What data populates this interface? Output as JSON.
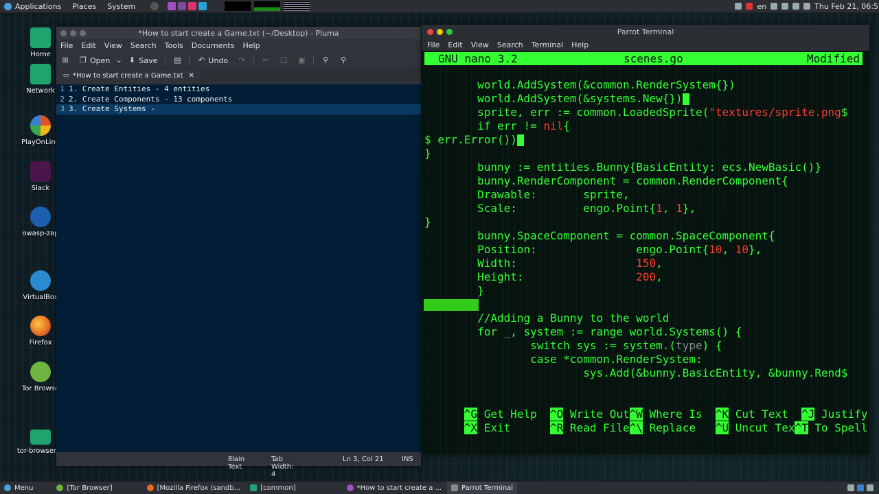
{
  "top_panel": {
    "applications": "Applications",
    "places": "Places",
    "system": "System",
    "keyboard_layout": "en",
    "clock": "Thu Feb 21, 06:55"
  },
  "desktop_icons": [
    {
      "label": "Home",
      "color": "#1fa36f"
    },
    {
      "label": "Network",
      "color": "#1fa36f"
    },
    {
      "label": "PlayOnLinu",
      "color": "#e0532a"
    },
    {
      "label": "Slack",
      "color": "#6a2b6a"
    },
    {
      "label": "owasp-zap",
      "color": "#1d5fae"
    },
    {
      "label": "VirtualBox",
      "color": "#2a8bd2"
    },
    {
      "label": "Firefox",
      "color": "#e66a1f"
    },
    {
      "label": "Tor Browse",
      "color": "#6fb43f"
    },
    {
      "label": "tor-browser_e",
      "color": "#1fa36f"
    }
  ],
  "pluma": {
    "title": "*How to start create a Game.txt (~/Desktop) - Pluma",
    "menu": [
      "File",
      "Edit",
      "View",
      "Search",
      "Tools",
      "Documents",
      "Help"
    ],
    "toolbar": {
      "open": "Open",
      "save": "Save",
      "undo": "Undo"
    },
    "tab_label": "*How to start create a Game.txt",
    "lines": [
      {
        "num": "1",
        "text": "1. Create Entities - 4 entities"
      },
      {
        "num": "2",
        "text": "2. Create Components - 13 components"
      },
      {
        "num": "3",
        "text": "3. Create Systems -"
      }
    ],
    "status": {
      "mode": "Plain Text",
      "tab_width": "Tab Width: 4",
      "position": "Ln 3, Col 21",
      "insert": "INS"
    }
  },
  "terminal": {
    "title": "Parrot Terminal",
    "menu": [
      "File",
      "Edit",
      "View",
      "Search",
      "Terminal",
      "Help"
    ],
    "nano": {
      "version": "GNU nano 3.2",
      "filename": "scenes.go",
      "state": "Modified"
    },
    "code": {
      "l1": "        world.AddSystem(&common.RenderSystem{})",
      "l2": "        world.AddSystem(&systems.New{})",
      "l3a": "        sprite, err := common.LoadedSprite(",
      "l3b": "\"textures/sprite.png",
      "l3c": "$",
      "l4a": "        if err != ",
      "l4b": "nil",
      "l4c": "{",
      "l5": "$ err.Error())",
      "l6": "}",
      "l7": "        bunny := entities.Bunny{BasicEntity: ecs.NewBasic()}",
      "l8": "        bunny.RenderComponent = common.RenderComponent{",
      "l9": "        Drawable:       sprite,",
      "l10a": "        Scale:          engo.Point{",
      "l10b": "1",
      "l10c": ", ",
      "l10d": "1",
      "l10e": "},",
      "l11": "}",
      "l12": "        bunny.SpaceComponent = common.SpaceComponent{",
      "l13a": "        Position:               engo.Point{",
      "l13b": "10",
      "l13c": ", ",
      "l13d": "10",
      "l13e": "},",
      "l14a": "        Width:                  ",
      "l14b": "150",
      "l14c": ",",
      "l15a": "        Height:                 ",
      "l15b": "200",
      "l15c": ",",
      "l16": "        }",
      "l17": "        //Adding a Bunny to the world",
      "l18": "        for _, system := range world.Systems() {",
      "l19a": "                switch sys := system.(",
      "l19b": "type",
      "l19c": ") {",
      "l20": "                case *common.RenderSystem:",
      "l21": "                        sys.Add(&bunny.BasicEntity, &bunny.Rend$"
    },
    "shortcuts_row1": [
      {
        "key": "^G",
        "label": " Get Help  "
      },
      {
        "key": "^O",
        "label": " Write Out"
      },
      {
        "key": "^W",
        "label": " Where Is  "
      },
      {
        "key": "^K",
        "label": " Cut Text  "
      },
      {
        "key": "^J",
        "label": " Justify"
      }
    ],
    "shortcuts_row2": [
      {
        "key": "^X",
        "label": " Exit      "
      },
      {
        "key": "^R",
        "label": " Read File"
      },
      {
        "key": "^\\",
        "label": " Replace   "
      },
      {
        "key": "^U",
        "label": " Uncut Tex"
      },
      {
        "key": "^T",
        "label": " To Spell"
      }
    ]
  },
  "bottom_panel": {
    "menu": "Menu",
    "tasks": [
      "[Tor Browser]",
      "[Mozilla Firefox (sandb...",
      "[common]",
      "*How to start create a ...",
      "Parrot Terminal"
    ]
  }
}
